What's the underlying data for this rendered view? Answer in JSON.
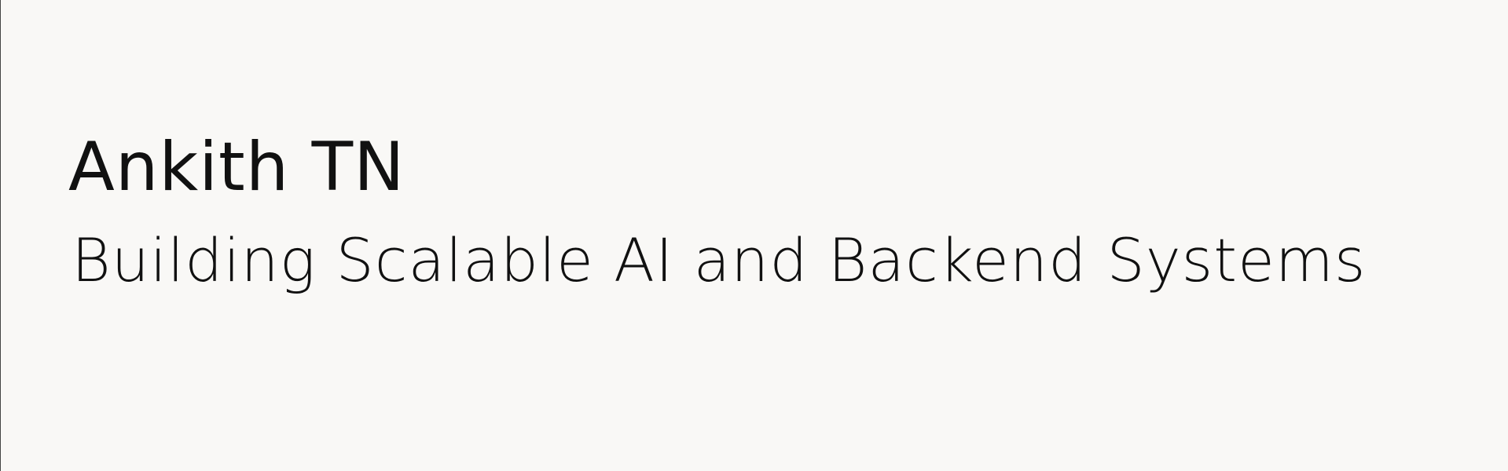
{
  "hero": {
    "name": "Ankith TN",
    "tagline": "Building Scalable AI and Backend Systems"
  },
  "colors": {
    "background": "#f9f8f6",
    "text": "#111111",
    "left_border": "#444444"
  }
}
